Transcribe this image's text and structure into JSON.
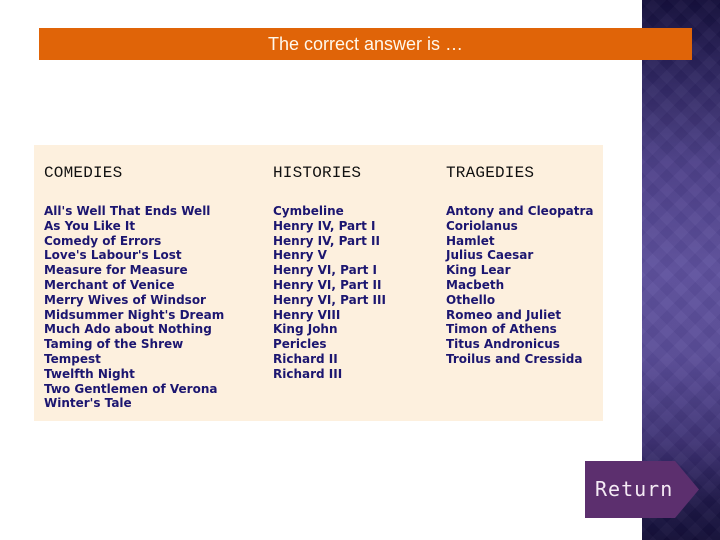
{
  "header": {
    "answer_text": "The correct answer is …"
  },
  "table": {
    "columns": [
      {
        "title": "COMEDIES",
        "items": [
          "All's Well That Ends Well",
          "As You Like It",
          "Comedy of Errors",
          "Love's Labour's Lost",
          "Measure for Measure",
          "Merchant of Venice",
          "Merry Wives of Windsor",
          "Midsummer Night's Dream",
          "Much Ado about Nothing",
          "Taming of the Shrew",
          "Tempest",
          "Twelfth Night",
          "Two Gentlemen of Verona",
          "Winter's Tale"
        ]
      },
      {
        "title": "HISTORIES",
        "items": [
          "Cymbeline",
          "Henry IV, Part I",
          "Henry IV, Part II",
          "Henry V",
          "Henry VI, Part I",
          "Henry VI, Part II",
          "Henry VI, Part III",
          "Henry VIII",
          "King John",
          "Pericles",
          "Richard II",
          "Richard III"
        ]
      },
      {
        "title": "TRAGEDIES",
        "items": [
          "Antony and Cleopatra",
          "Coriolanus",
          "Hamlet",
          "Julius Caesar",
          "King Lear",
          "Macbeth",
          "Othello",
          "Romeo and Juliet",
          "Timon of Athens",
          "Titus Andronicus",
          "Troilus and Cressida"
        ]
      }
    ]
  },
  "navigation": {
    "return_label": "Return"
  },
  "colors": {
    "accent_orange": "#e06408",
    "table_background": "#fdf0de",
    "item_text": "#1c1670",
    "return_button": "#5c2f6e"
  }
}
